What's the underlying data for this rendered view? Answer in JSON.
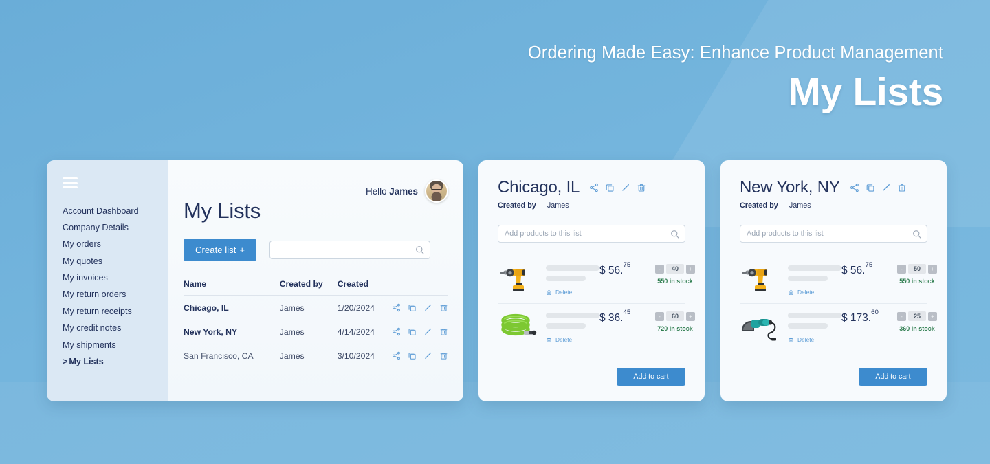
{
  "hero": {
    "kicker": "Ordering Made Easy: Enhance Product Management",
    "title": "My Lists"
  },
  "theme": {
    "background_top": "#6aadd8",
    "background_bottom": "#7bb9df",
    "card_bg": "#f7fafd",
    "sidebar_bg": "#dbe8f4",
    "accent_blue": "#3d8bce",
    "icon_blue": "#5b9bd5",
    "text_navy": "#23325c",
    "stock_green": "#2e7d4f"
  },
  "sidebar": {
    "menu_icon": "hamburger-icon",
    "items": [
      {
        "label": "Account Dashboard",
        "active": false
      },
      {
        "label": "Company Details",
        "active": false
      },
      {
        "label": "My orders",
        "active": false
      },
      {
        "label": "My quotes",
        "active": false
      },
      {
        "label": "My invoices",
        "active": false
      },
      {
        "label": "My return orders",
        "active": false
      },
      {
        "label": "My return receipts",
        "active": false
      },
      {
        "label": "My credit notes",
        "active": false
      },
      {
        "label": "My shipments",
        "active": false
      },
      {
        "label": "My Lists",
        "active": true,
        "chevron": ">"
      }
    ]
  },
  "main": {
    "greeting_prefix": "Hello ",
    "greeting_name": "James",
    "avatar_icon": "user-avatar",
    "page_title": "My Lists",
    "create_button": "Create list",
    "create_button_plus": "+",
    "search_placeholder": "",
    "search_value": "",
    "search_icon": "search-icon",
    "table": {
      "columns": [
        "Name",
        "Created by",
        "Created"
      ],
      "rows": [
        {
          "name": "Chicago, IL",
          "created_by": "James",
          "created": "1/20/2024",
          "bold": true
        },
        {
          "name": "New York, NY",
          "created_by": "James",
          "created": "4/14/2024",
          "bold": true
        },
        {
          "name": "San Francisco, CA",
          "created_by": "James",
          "created": "3/10/2024",
          "bold": false
        }
      ],
      "row_action_icons": [
        "share-icon",
        "copy-icon",
        "edit-pencil-icon",
        "trash-icon"
      ]
    }
  },
  "list_cards": [
    {
      "title": "Chicago, IL",
      "created_by_label": "Created by",
      "created_by_name": "James",
      "action_icons": [
        "share-icon",
        "copy-icon",
        "edit-pencil-icon",
        "trash-icon"
      ],
      "add_placeholder": "Add products to this list",
      "add_value": "",
      "add_to_cart_label": "Add to cart",
      "products": [
        {
          "image": "cordless-drill-yellow",
          "price_main": "$ 56.",
          "price_cents": "75",
          "qty": "40",
          "stock": "550 in stock",
          "delete_label": "Delete"
        },
        {
          "image": "garden-hose-green",
          "price_main": "$ 36.",
          "price_cents": "45",
          "qty": "60",
          "stock": "720 in stock",
          "delete_label": "Delete"
        }
      ]
    },
    {
      "title": "New York, NY",
      "created_by_label": "Created by",
      "created_by_name": "James",
      "action_icons": [
        "share-icon",
        "copy-icon",
        "edit-pencil-icon",
        "trash-icon"
      ],
      "add_placeholder": "Add products to this list",
      "add_value": "",
      "add_to_cart_label": "Add to cart",
      "products": [
        {
          "image": "cordless-drill-yellow",
          "price_main": "$ 56.",
          "price_cents": "75",
          "qty": "50",
          "stock": "550 in stock",
          "delete_label": "Delete"
        },
        {
          "image": "angle-grinder-teal",
          "price_main": "$ 173.",
          "price_cents": "60",
          "qty": "25",
          "stock": "360 in stock",
          "delete_label": "Delete"
        }
      ]
    }
  ],
  "stepper": {
    "minus": "-",
    "plus": "+"
  }
}
